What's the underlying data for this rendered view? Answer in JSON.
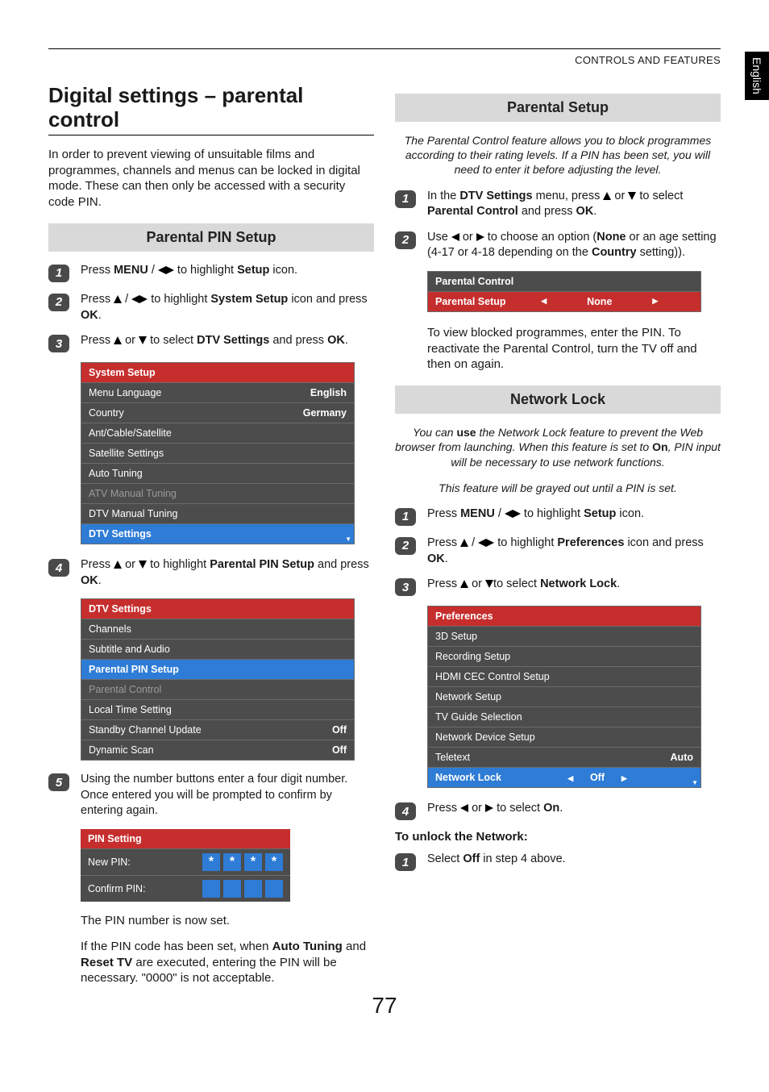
{
  "page": {
    "header": "CONTROLS AND FEATURES",
    "side_tab": "English",
    "page_number": "77"
  },
  "left": {
    "title": "Digital settings – parental control",
    "intro": "In order to prevent viewing of unsuitable films and programmes, channels and menus can be locked in digital mode. These can then only be accessed with a security code PIN.",
    "sub1": "Parental PIN Setup",
    "step1": {
      "pre": "Press ",
      "menu": "MENU",
      "mid": " / ",
      "after": " to highlight ",
      "setup": "Setup",
      "end": " icon."
    },
    "step2": {
      "pre": "Press ",
      "mid": " / ",
      "after": " to highlight ",
      "target": "System Setup",
      "end": " icon and press ",
      "ok": "OK",
      "dot": "."
    },
    "step3": {
      "pre": "Press ",
      "or": " or ",
      "after": " to select ",
      "target": "DTV Settings",
      "end": " and press ",
      "ok": "OK",
      "dot": "."
    },
    "system_setup": {
      "title": "System Setup",
      "rows": [
        {
          "label": "Menu Language",
          "value": "English"
        },
        {
          "label": "Country",
          "value": "Germany"
        },
        {
          "label": "Ant/Cable/Satellite",
          "value": ""
        },
        {
          "label": "Satellite Settings",
          "value": ""
        },
        {
          "label": "Auto Tuning",
          "value": ""
        },
        {
          "label": "ATV Manual Tuning",
          "value": "",
          "disabled": true
        },
        {
          "label": "DTV Manual Tuning",
          "value": ""
        },
        {
          "label": "DTV Settings",
          "value": "",
          "selected": true
        }
      ]
    },
    "step4": {
      "pre": "Press ",
      "or": " or ",
      "after": " to highlight ",
      "target": "Parental PIN Setup",
      "end": " and press ",
      "ok": "OK",
      "dot": "."
    },
    "dtv_settings": {
      "title": "DTV Settings",
      "rows": [
        {
          "label": "Channels",
          "value": ""
        },
        {
          "label": "Subtitle and Audio",
          "value": ""
        },
        {
          "label": "Parental PIN Setup",
          "value": "",
          "selected": true
        },
        {
          "label": "Parental Control",
          "value": "",
          "disabled": true
        },
        {
          "label": "Local Time Setting",
          "value": ""
        },
        {
          "label": "Standby Channel Update",
          "value": "Off"
        },
        {
          "label": "Dynamic Scan",
          "value": "Off"
        }
      ]
    },
    "step5": "Using the number buttons enter a four digit number. Once entered you will be prompted to confirm by entering again.",
    "pin_setting": {
      "title": "PIN Setting",
      "new_pin": "New PIN:",
      "confirm": "Confirm PIN:",
      "stars": [
        "*",
        "*",
        "*",
        "*"
      ]
    },
    "after_pin": "The PIN number is now set.",
    "pin_note": {
      "pre": "If the PIN code has been set, when ",
      "a": "Auto Tuning",
      "and": " and ",
      "b": "Reset TV",
      "post": " are executed, entering the PIN will be necessary. \"0000\" is not acceptable."
    }
  },
  "right": {
    "sub1": "Parental Setup",
    "intro": "The Parental Control feature allows you to block programmes according to their rating levels. If a PIN has been set, you will need to enter it before adjusting the level.",
    "step1": {
      "pre": "In the ",
      "a": "DTV Settings",
      "mid": " menu, press ",
      "or": " or ",
      "after": " to select ",
      "b": "Parental Control",
      "end": " and press ",
      "ok": "OK",
      "dot": "."
    },
    "step2": {
      "pre": "Use ",
      "or": " or ",
      "mid": " to choose an option (",
      "none": "None",
      "after": " or an age setting (4-17 or 4-18 depending on the ",
      "country": "Country",
      "end": " setting))."
    },
    "parental_control_box": {
      "title": "Parental Control",
      "row_label": "Parental Setup",
      "row_value": "None"
    },
    "after_box": "To view blocked programmes, enter the PIN. To reactivate the Parental Control, turn the TV off and then on again.",
    "sub2": "Network Lock",
    "nl_intro": {
      "pre": "You can ",
      "use": "use",
      "mid": " the Network Lock feature to prevent the Web browser from launching. When this feature is set to ",
      "on": "On",
      "post": ", PIN input will be necessary to use network functions."
    },
    "nl_gray": "This feature will be grayed out until a PIN is set.",
    "nl_step1": {
      "pre": "Press ",
      "menu": "MENU",
      "mid": " / ",
      "after": " to highlight ",
      "setup": "Setup",
      "end": " icon."
    },
    "nl_step2": {
      "pre": "Press ",
      "mid": " / ",
      "after": " to highlight ",
      "target": "Preferences",
      "end": " icon and press ",
      "ok": "OK",
      "dot": "."
    },
    "nl_step3": {
      "pre": "Press ",
      "or": " or ",
      "after": "to select ",
      "target": "Network Lock",
      "dot": "."
    },
    "prefs_box": {
      "title": "Preferences",
      "rows": [
        {
          "label": "3D Setup",
          "value": ""
        },
        {
          "label": "Recording Setup",
          "value": ""
        },
        {
          "label": "HDMI CEC Control Setup",
          "value": ""
        },
        {
          "label": "Network Setup",
          "value": ""
        },
        {
          "label": "TV Guide Selection",
          "value": ""
        },
        {
          "label": "Network Device Setup",
          "value": ""
        },
        {
          "label": "Teletext",
          "value": "Auto"
        },
        {
          "label": "Network Lock",
          "value": "Off",
          "selected": true
        }
      ]
    },
    "nl_step4": {
      "pre": "Press ",
      "or": " or ",
      "after": " to select ",
      "on": "On",
      "dot": "."
    },
    "unlock_head": "To unlock the Network:",
    "unlock_step": {
      "pre": "Select ",
      "off": "Off",
      "post": " in step 4 above."
    }
  }
}
